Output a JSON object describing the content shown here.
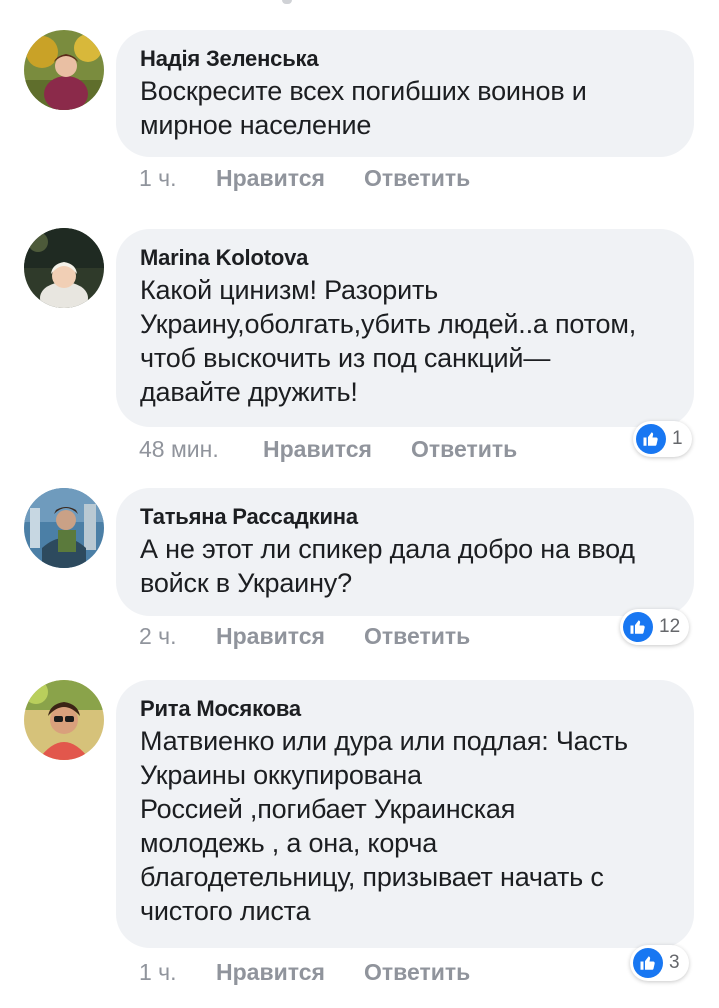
{
  "comments": [
    {
      "author": "Надія Зеленська",
      "text": "Воскресите всех погибших воинов и\nмирное население",
      "time": "1 ч.",
      "like_label": "Нравится",
      "reply_label": "Ответить",
      "reactions": null
    },
    {
      "author": "Marina Kolotova",
      "text": "Какой цинизм! Разорить\nУкраину,оболгать,убить людей..а потом,\nчтоб выскочить из под санкций—\nдавайте дружить!",
      "time": "48 мин.",
      "like_label": "Нравится",
      "reply_label": "Ответить",
      "reactions": "1"
    },
    {
      "author": "Татьяна Рассадкина",
      "text": "А не этот ли спикер дала добро на ввод\nвойск в Украину?",
      "time": "2 ч.",
      "like_label": "Нравится",
      "reply_label": "Ответить",
      "reactions": "12"
    },
    {
      "author": "Рита Мосякова",
      "text": "Матвиенко или дура или подлая:  Часть\nУкраины оккупирована\nРоссией ,погибает Украинская\nмолодежь , а  она, корча\nблагодетельницу, призывает начать с\nчистого листа",
      "time": "1 ч.",
      "like_label": "Нравится",
      "reply_label": "Ответить",
      "reactions": "3"
    }
  ],
  "colors": {
    "bubble_bg": "#f0f2f5",
    "like_blue": "#1877f2",
    "meta_gray": "#90949c"
  },
  "icons": {
    "reaction": "like-thumbs-up-icon"
  }
}
